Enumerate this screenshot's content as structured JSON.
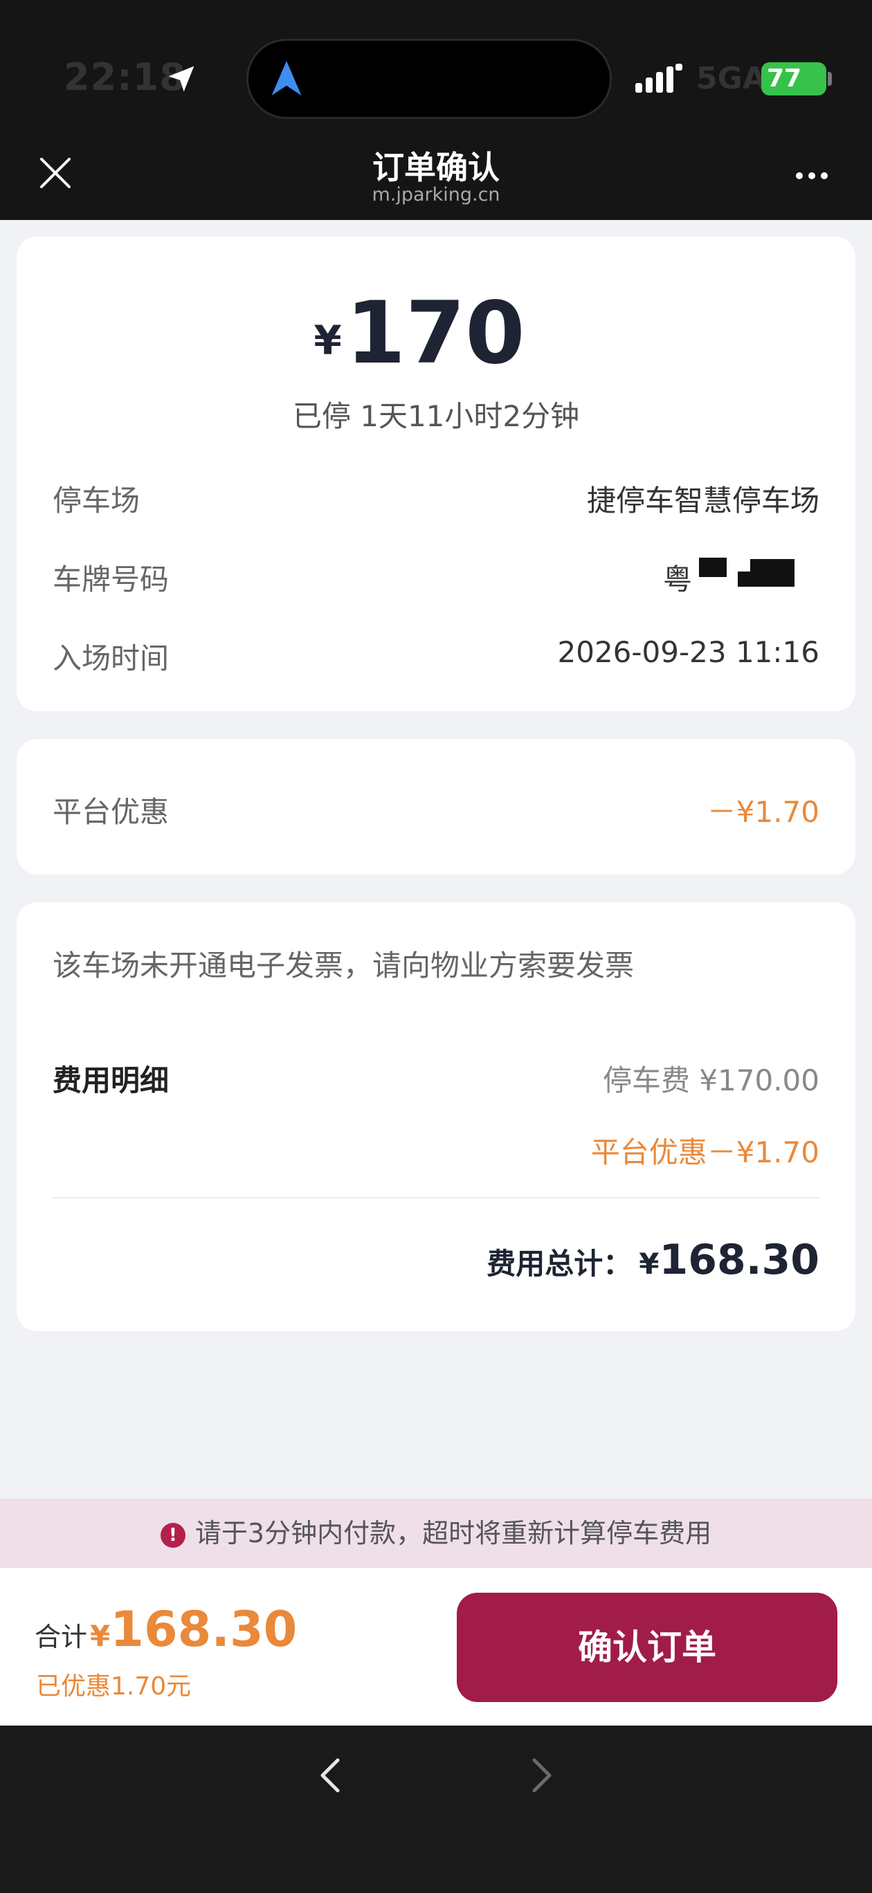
{
  "status_bar": {
    "time": "22:18",
    "network": "5GA",
    "battery": "77"
  },
  "nav": {
    "title": "订单确认",
    "subtitle": "m.jparking.cn"
  },
  "order": {
    "currency": "¥",
    "amount": "170",
    "duration": "已停 1天11小时2分钟",
    "rows": [
      {
        "label": "停车场",
        "value": "捷停车智慧停车场"
      },
      {
        "label": "车牌号码",
        "value": "粤"
      },
      {
        "label": "入场时间",
        "value": "2026-09-23 11:16"
      }
    ]
  },
  "discount": {
    "label": "平台优惠",
    "value": "－¥1.70"
  },
  "invoice": {
    "note": "该车场未开通电子发票，请向物业方索要发票",
    "detail_label": "费用明细",
    "parking_fee": "停车费 ¥170.00",
    "platform_discount": "平台优惠－¥1.70",
    "total_label": "费用总计：",
    "total_currency": "¥",
    "total_value": "168.30"
  },
  "warning": {
    "icon": "!",
    "text": "请于3分钟内付款，超时将重新计算停车费用"
  },
  "paybar": {
    "total_label": "合计",
    "currency": "¥",
    "total": "168.30",
    "saved": "已优惠1.70元",
    "confirm_label": "确认订单"
  },
  "colors": {
    "accent": "#a11c49",
    "discount": "#e9893a",
    "battery": "#37c24b"
  }
}
